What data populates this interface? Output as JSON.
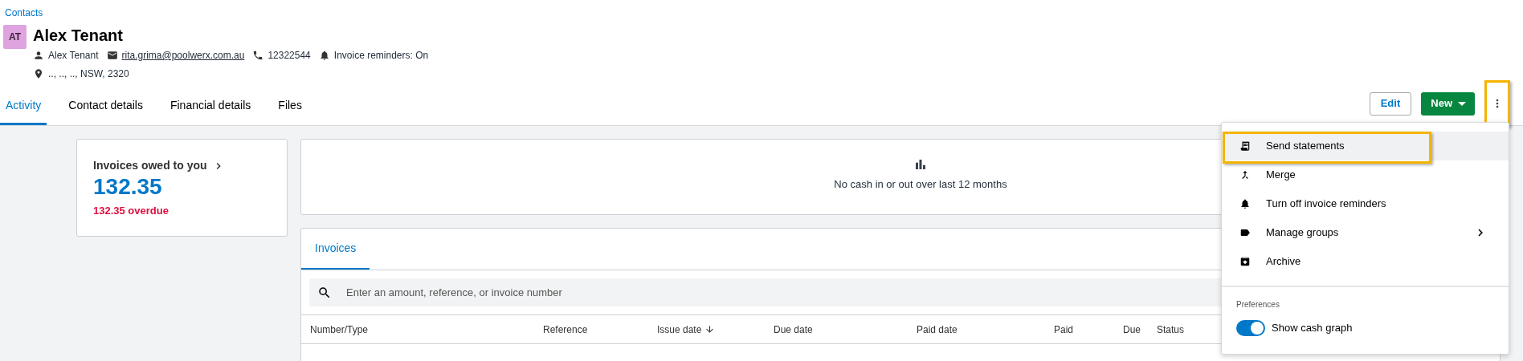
{
  "breadcrumb": "Contacts",
  "contact": {
    "initials": "AT",
    "name": "Alex Tenant",
    "details": [
      {
        "kind": "person",
        "text": "Alex Tenant"
      },
      {
        "kind": "email",
        "text": "rita.grima@poolwerx.com.au"
      },
      {
        "kind": "phone",
        "text": "12322544"
      },
      {
        "kind": "bell",
        "text": "Invoice reminders: On"
      }
    ],
    "address": ".., .., .., NSW, 2320"
  },
  "tabs": [
    {
      "label": "Activity",
      "selected": true
    },
    {
      "label": "Contact details",
      "selected": false
    },
    {
      "label": "Financial details",
      "selected": false
    },
    {
      "label": "Files",
      "selected": false
    }
  ],
  "actions": {
    "edit": "Edit",
    "new": "New",
    "more_highlighted": true
  },
  "summary": {
    "title": "Invoices owed to you",
    "amount": "132.35",
    "overdue": "132.35 overdue"
  },
  "cash": {
    "message": "No cash in or out over last 12 months"
  },
  "invoices": {
    "tabs": [
      {
        "label": "Invoices",
        "selected": true
      }
    ],
    "search": {
      "placeholder": "Enter an amount, reference, or invoice number"
    },
    "columns": [
      {
        "label": "Number/Type",
        "sorted": false
      },
      {
        "label": "Reference",
        "sorted": false
      },
      {
        "label": "Issue date",
        "sorted": true
      },
      {
        "label": "Due date",
        "sorted": false
      },
      {
        "label": "Paid date",
        "sorted": false
      },
      {
        "label": "Paid",
        "sorted": false
      },
      {
        "label": "Due",
        "sorted": false
      },
      {
        "label": "Status",
        "sorted": false
      }
    ]
  },
  "menu": {
    "items": [
      {
        "kind": "statement",
        "label": "Send statements",
        "highlighted": true,
        "submenu": false
      },
      {
        "kind": "merge",
        "label": "Merge",
        "highlighted": false,
        "submenu": false
      },
      {
        "kind": "bell",
        "label": "Turn off invoice reminders",
        "highlighted": false,
        "submenu": false
      },
      {
        "kind": "tag",
        "label": "Manage groups",
        "highlighted": false,
        "submenu": true
      },
      {
        "kind": "archive",
        "label": "Archive",
        "highlighted": false,
        "submenu": false
      }
    ],
    "section": "Preferences",
    "toggle": {
      "label": "Show cash graph",
      "on": true
    }
  }
}
